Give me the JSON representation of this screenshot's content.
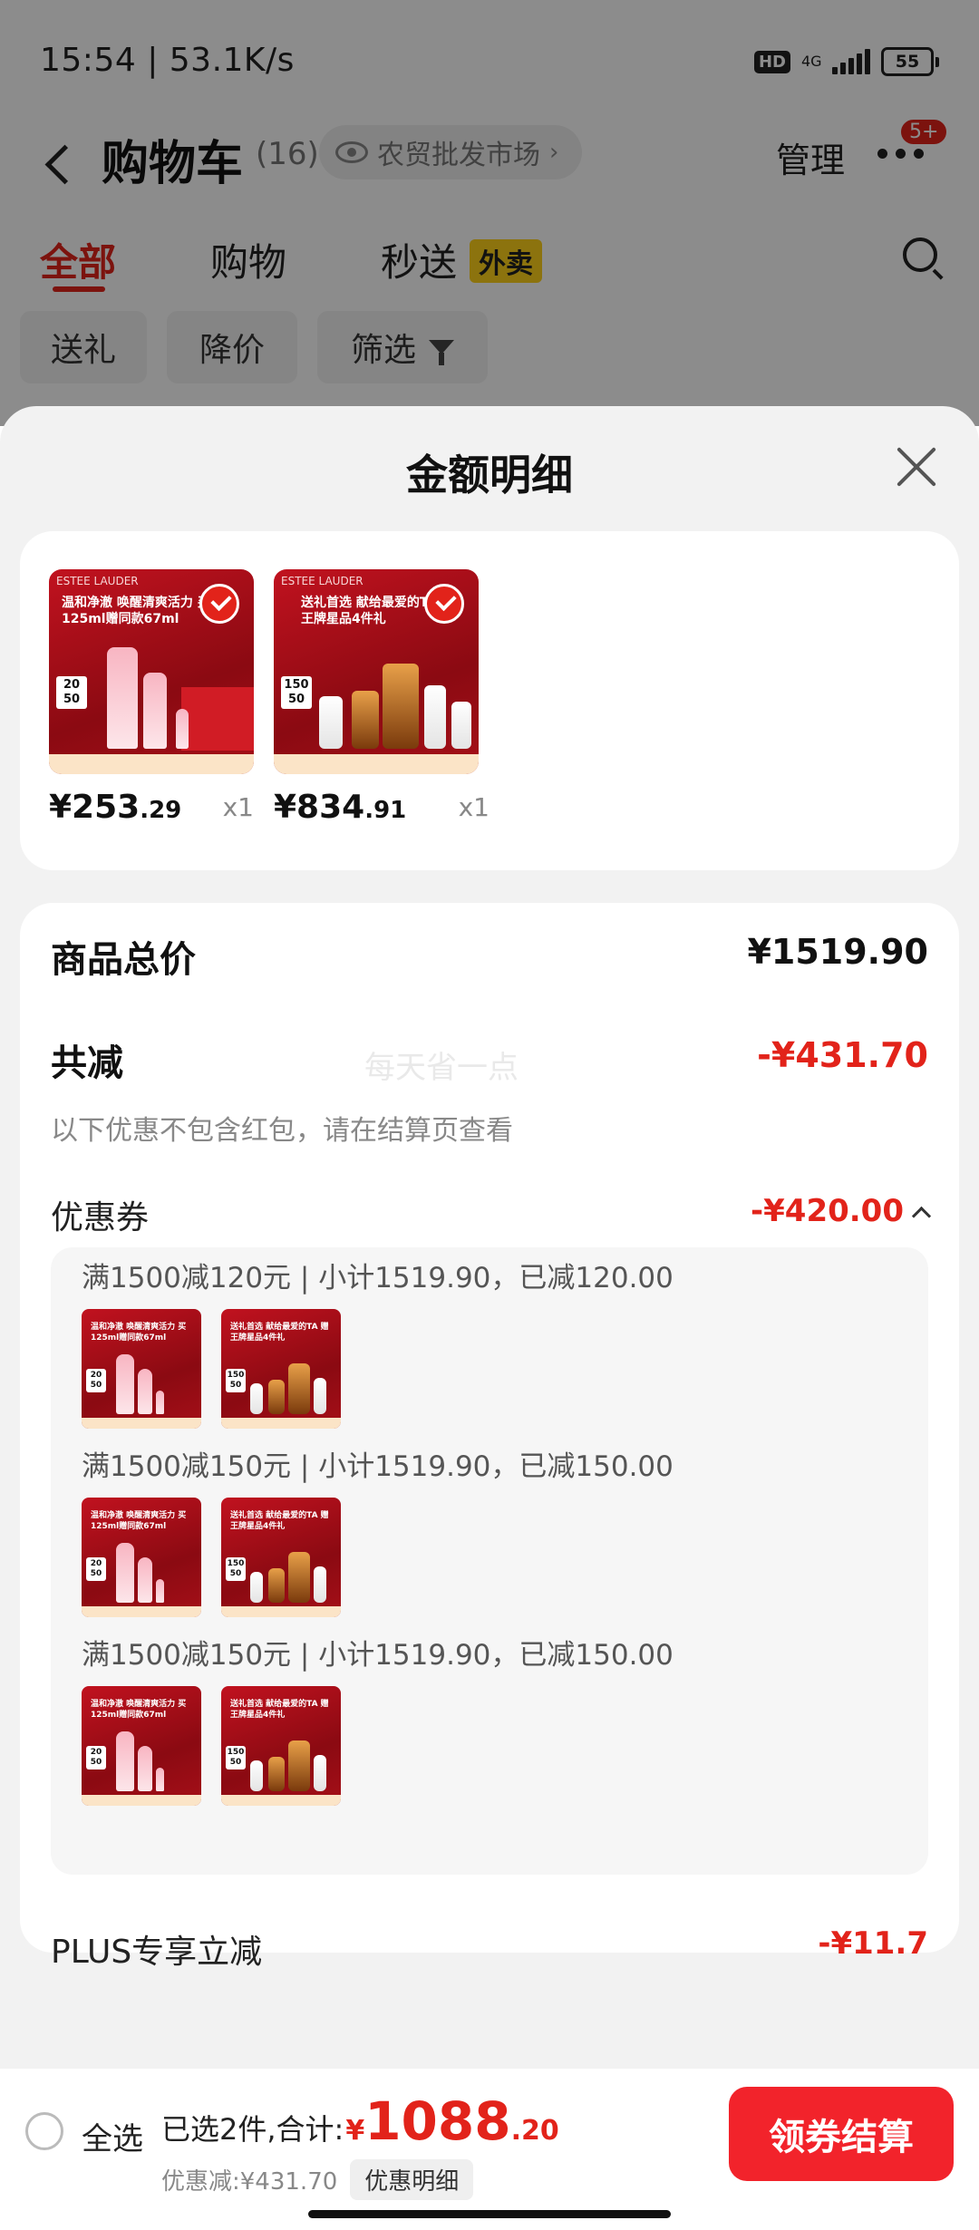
{
  "status": {
    "time": "15:54 | 53.1K/s",
    "hd": "HD",
    "network": "4G",
    "battery": "55"
  },
  "nav": {
    "title": "购物车",
    "count": "(16)",
    "location": "农贸批发市场",
    "manage": "管理",
    "badge": "5+"
  },
  "tabs": {
    "all": "全部",
    "shop": "购物",
    "seconds": "秒送",
    "takeout_badge": "外卖"
  },
  "filters": {
    "gift": "送礼",
    "price_drop": "降价",
    "filter": "筛选"
  },
  "sheet": {
    "title": "金额明细",
    "products": [
      {
        "price_int": "¥253",
        "price_dec": ".29",
        "qty": "x1",
        "thumb_slogan": "温和净澈 唤醒清爽活力 买125ml赠同款67ml",
        "thumb_brand": "ESTEE LAUDER",
        "tag_top": "20",
        "tag_bottom": "50"
      },
      {
        "price_int": "¥834",
        "price_dec": ".91",
        "qty": "x1",
        "thumb_slogan": "送礼首选 献给最爱的TA 赠王牌星品4件礼",
        "thumb_brand": "ESTEE LAUDER",
        "tag_top": "150",
        "tag_bottom": "50"
      }
    ],
    "total_label": "商品总价",
    "total_value": "¥1519.90",
    "reduce_label": "共减",
    "reduce_value": "-¥431.70",
    "watermark": "每天省一点",
    "note": "以下优惠不包含红包，请在结算页查看",
    "coupon_label": "优惠券",
    "coupon_value": "-¥420.00",
    "coupon_groups": [
      {
        "text": "满1500减120元 | 小计1519.90，已减120.00"
      },
      {
        "text": "满1500减150元 | 小计1519.90，已减150.00"
      },
      {
        "text": "满1500减150元 | 小计1519.90，已减150.00"
      }
    ],
    "plus_label": "PLUS专享立减",
    "plus_value": "-¥11.7"
  },
  "bottom": {
    "select_all": "全选",
    "summary": "已选2件,合计:",
    "currency": "¥",
    "total_int": "1088",
    "total_dec": ".20",
    "discount": "优惠减:¥431.70",
    "detail_chip": "优惠明细",
    "checkout": "领券结算"
  },
  "colors": {
    "accent": "#e2231a",
    "checkout": "#f2232b",
    "badge": "#ffd21a"
  }
}
